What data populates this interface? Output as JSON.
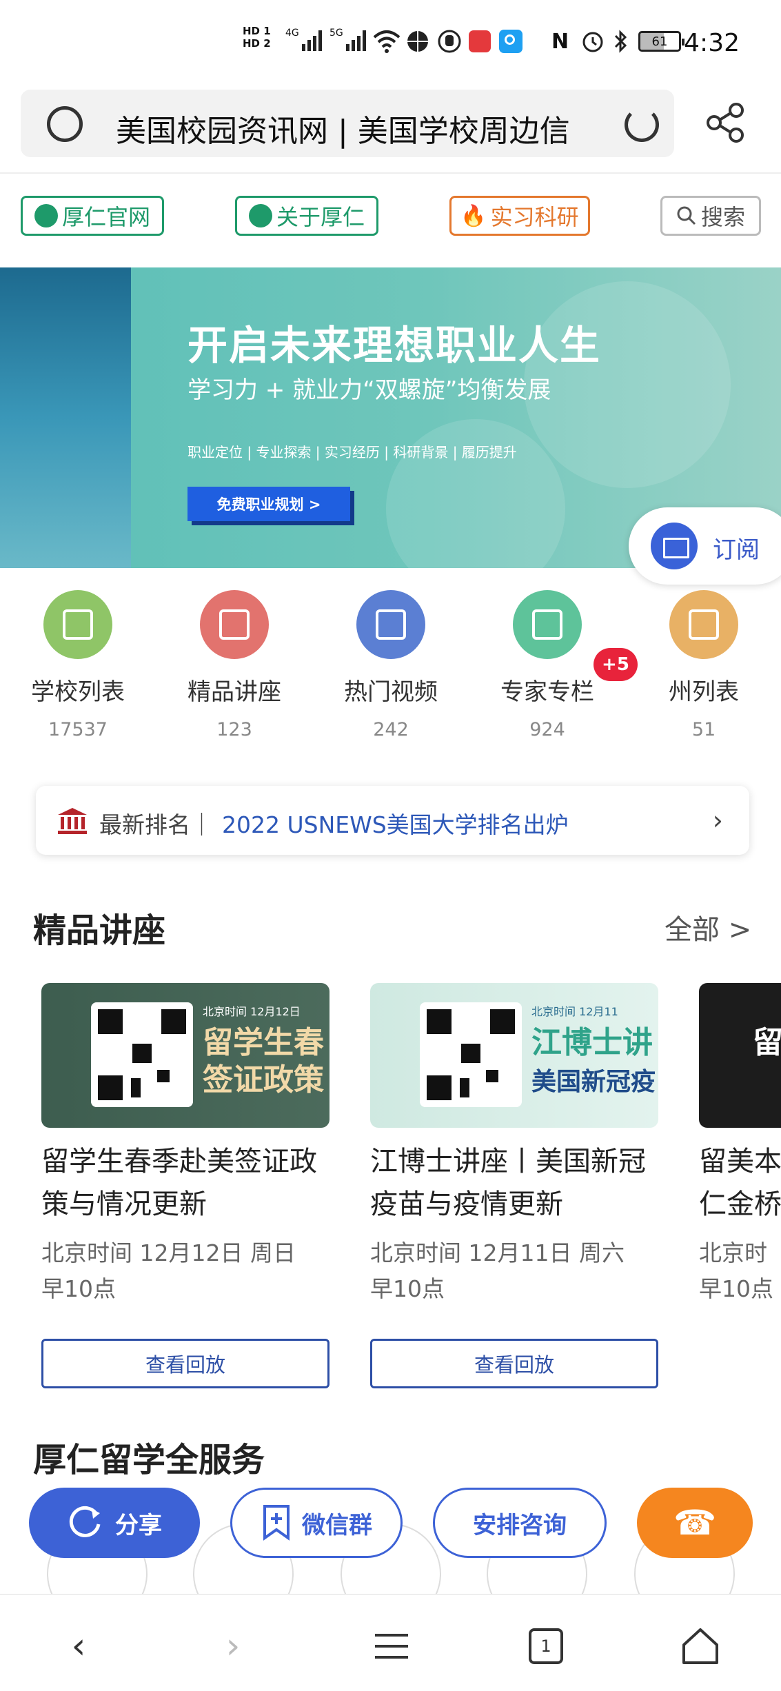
{
  "status_bar": {
    "time": "4:32",
    "battery": "61",
    "network_1": "4G",
    "network_2": "5G",
    "hd1": "HD 1",
    "hd2": "HD 2"
  },
  "browser": {
    "url_title": "美国校园资讯网 | 美国学校周边信"
  },
  "top_nav": [
    {
      "label": "厚仁官网",
      "color": "#1e9a6a"
    },
    {
      "label": "关于厚仁",
      "color": "#1e9a6a"
    },
    {
      "label": "实习科研",
      "color": "#e4782e"
    },
    {
      "label": "搜索",
      "color": "#888888"
    }
  ],
  "banner": {
    "headline": "开启未来理想职业人生",
    "subline": "学习力 + 就业力“双螺旋”均衡发展",
    "tags": "职业定位 | 专业探索 | 实习经历 | 科研背景 | 履历提升",
    "cta": "免费职业规划 >"
  },
  "subscribe": {
    "label": "订阅"
  },
  "categories": [
    {
      "name": "学校列表",
      "count": "17537",
      "color": "#8fc567"
    },
    {
      "name": "精品讲座",
      "count": "123",
      "color": "#e2736e"
    },
    {
      "name": "热门视频",
      "count": "242",
      "color": "#5b7fd3"
    },
    {
      "name": "专家专栏",
      "count": "924",
      "color": "#5ec39a"
    },
    {
      "name": "州列表",
      "count": "51",
      "color": "#e8b165"
    }
  ],
  "expert_badge": "+5",
  "ranking": {
    "label": "最新排名｜",
    "link": "2022 USNEWS美国大学排名出炉"
  },
  "lectures": {
    "title": "精品讲座",
    "all_label": "全部 >",
    "items": [
      {
        "img_date": "北京时间   12月12日",
        "img_head": "留学生春",
        "img_head2": "签证政策",
        "title_l1": "留学生春季赴美签证政",
        "title_l2": "策与情况更新",
        "time_l1": "北京时间 12月12日 周日",
        "time_l2": "早10点",
        "button": "查看回放"
      },
      {
        "img_date": "北京时间   12月11",
        "img_head": "江博士讲",
        "img_head2": "美国新冠疫",
        "title_l1": "江博士讲座丨美国新冠",
        "title_l2": "疫苗与疫情更新",
        "time_l1": "北京时间 12月11日 周六",
        "time_l2": "早10点",
        "button": "查看回放"
      },
      {
        "img_date": "",
        "img_head": "留",
        "img_head2": "",
        "title_l1": "留美本",
        "title_l2": "仁金桥",
        "time_l1": "北京时",
        "time_l2": "早10点",
        "button": ""
      }
    ]
  },
  "services": {
    "title": "厚仁留学全服务"
  },
  "float_buttons": [
    {
      "label": "分享"
    },
    {
      "label": "微信群"
    },
    {
      "label": "安排咨询"
    }
  ],
  "nav_tab_count": "1"
}
